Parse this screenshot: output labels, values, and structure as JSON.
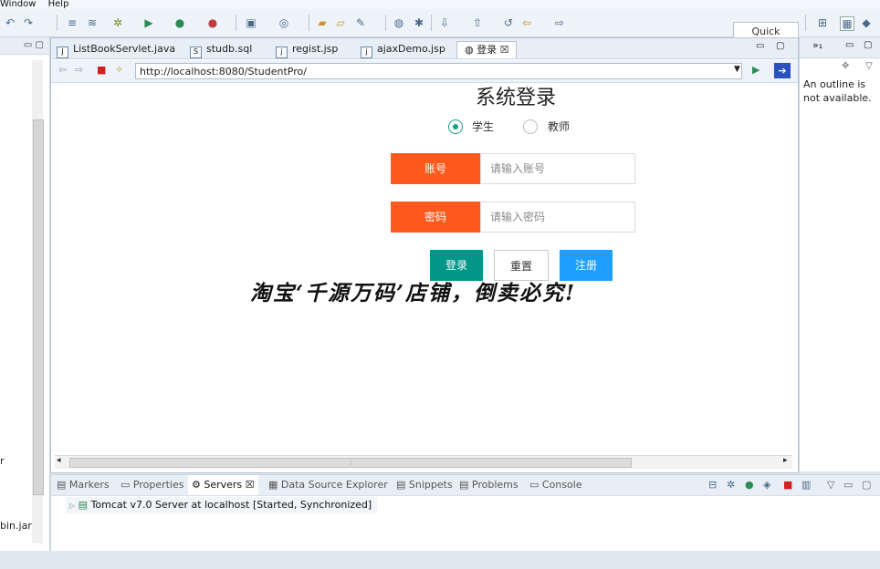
{
  "menu": {
    "window": "Window",
    "help": "Help"
  },
  "toolbar": {
    "quick_access": "Quick Access"
  },
  "left_panel": {
    "frag1": "r",
    "frag2": "bin.jar"
  },
  "editor_tabs": [
    {
      "label": "ListBookServlet.java"
    },
    {
      "label": "studb.sql"
    },
    {
      "label": "regist.jsp"
    },
    {
      "label": "ajaxDemo.jsp"
    },
    {
      "label": "登录"
    }
  ],
  "browser": {
    "url": "http://localhost:8080/StudentPro/"
  },
  "login": {
    "title": "系统登录",
    "role_student": "学生",
    "role_teacher": "教师",
    "selected_role": "学生",
    "account_label": "账号",
    "account_placeholder": "请输入账号",
    "password_label": "密码",
    "password_placeholder": "请输入密码",
    "login_button": "登录",
    "reset_button": "重置",
    "register_button": "注册"
  },
  "watermark": "淘宝‘千源万码’店铺，倒卖必究!",
  "outline": {
    "message": "An outline is not available."
  },
  "bottom_tabs": [
    {
      "label": "Markers"
    },
    {
      "label": "Properties"
    },
    {
      "label": "Servers"
    },
    {
      "label": "Data Source Explorer"
    },
    {
      "label": "Snippets"
    },
    {
      "label": "Problems"
    },
    {
      "label": "Console"
    }
  ],
  "server": {
    "name": "Tomcat v7.0 Server at localhost",
    "status": "[Started, Synchronized]"
  },
  "colors": {
    "orange": "#fe5a1e",
    "teal": "#009688",
    "blue": "#1e9fff"
  }
}
